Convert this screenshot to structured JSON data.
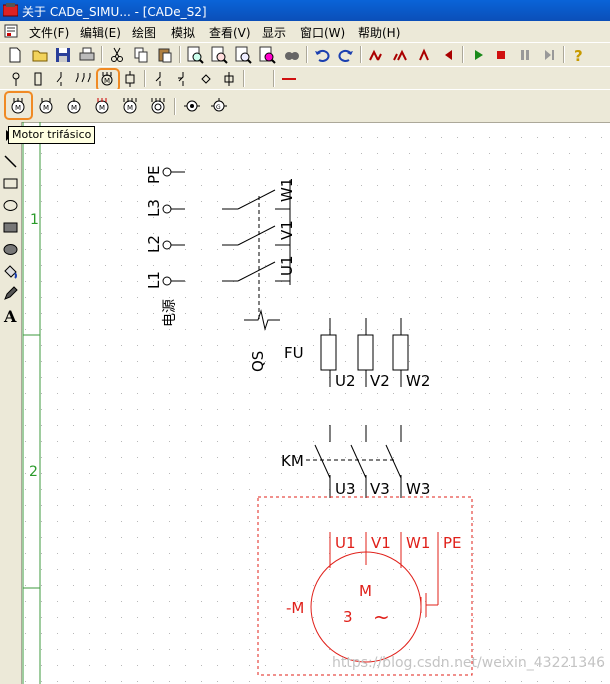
{
  "window": {
    "title": "关于 CADe_SIMU... - [CADe_S2]"
  },
  "menu": {
    "items": [
      "文件(F)",
      "编辑(E)",
      "绘图",
      "模拟",
      "查看(V)",
      "显示",
      "窗口(W)",
      "帮助(H)"
    ]
  },
  "toolbar_main": {
    "buttons": [
      "new-icon",
      "open-icon",
      "save-icon",
      "print-icon",
      "cut-icon",
      "copy-icon",
      "paste-icon",
      "zoom-in-icon",
      "zoom-out-icon",
      "zoom-fit-icon",
      "zoom-window-icon",
      "undo-icon",
      "redo-icon",
      "rotate-left-icon",
      "rotate-right-icon",
      "mirror-icon",
      "play-icon",
      "stop-icon",
      "pause-icon",
      "step-icon",
      "help-icon"
    ],
    "highlight_color": "#f08a24"
  },
  "toolbar_components": {
    "buttons": [
      "supply-terminal-icon",
      "fuse-icon",
      "contact-icon",
      "triple-contact-icon",
      "motor-group-icon",
      "coil-icon",
      "switch-icon",
      "switch-alt-icon",
      "diamond-icon",
      "cross-icon",
      "line-red-icon"
    ],
    "selected": "motor-group-icon"
  },
  "toolbar_motors": {
    "buttons": [
      "motor-three-phase-icon",
      "motor-icon-2",
      "motor-icon-3",
      "motor-icon-4",
      "motor-icon-5",
      "motor-icon-6",
      "motor-icon-7",
      "motor-icon-8"
    ],
    "selected": "motor-three-phase-icon"
  },
  "tooltip": {
    "text": "Motor trifásico"
  },
  "tools_left": [
    "pointer-icon",
    "line-icon",
    "rectangle-icon",
    "ellipse-icon",
    "filled-rect-icon",
    "filled-ellipse-icon",
    "fill-icon",
    "pen-icon",
    "text-icon"
  ],
  "tool_text_label": "A",
  "canvas": {
    "rows": [
      "1",
      "2"
    ],
    "supply": {
      "pe": "PE",
      "l3": "L3",
      "l2": "L2",
      "l1": "L1",
      "source_label": "电源"
    },
    "switch": {
      "label": "QS",
      "terminals": [
        "U1",
        "V1",
        "W1"
      ]
    },
    "fuses": {
      "label": "FU",
      "terminals": [
        "U2",
        "V2",
        "W2"
      ]
    },
    "contactor": {
      "label": "KM",
      "terminals": [
        "U3",
        "V3",
        "W3"
      ]
    },
    "motor": {
      "terminals": [
        "U1",
        "V1",
        "W1",
        "PE"
      ],
      "name": "M",
      "phases": "3",
      "tag": "-M",
      "ac_symbol": "~",
      "color": "#e0201a"
    }
  },
  "watermark": "https://blog.csdn.net/weixin_43221346"
}
